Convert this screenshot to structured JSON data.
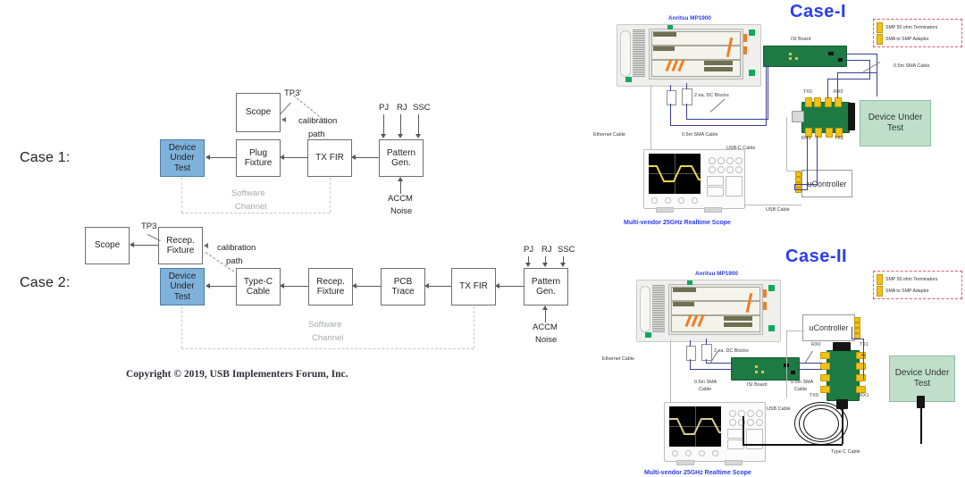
{
  "left_diagram": {
    "case1": {
      "label": "Case 1:",
      "blocks": [
        {
          "id": "dut",
          "text": "Device\nUnder\nTest"
        },
        {
          "id": "plug_fixture",
          "text": "Plug\nFixture"
        },
        {
          "id": "tx_fir",
          "text": "TX FIR"
        },
        {
          "id": "pattern_gen",
          "text": "Pattern\nGen."
        },
        {
          "id": "scope",
          "text": "Scope"
        }
      ],
      "annotations": {
        "tp": "TP3'",
        "calibration_path_line1": "calibration",
        "calibration_path_line2": "path",
        "software_line1": "Software",
        "software_line2": "Channel",
        "accm_line1": "ACCM",
        "accm_line2": "Noise",
        "pj": "PJ",
        "rj": "RJ",
        "ssc": "SSC"
      }
    },
    "case2": {
      "label": "Case 2:",
      "blocks": [
        {
          "id": "scope",
          "text": "Scope"
        },
        {
          "id": "recep_fixture_top",
          "text": "Recep.\nFixture"
        },
        {
          "id": "dut",
          "text": "Device\nUnder\nTest"
        },
        {
          "id": "type_c_cable",
          "text": "Type-C\nCable"
        },
        {
          "id": "recep_fixture",
          "text": "Recep.\nFixture"
        },
        {
          "id": "pcb_trace",
          "text": "PCB\nTrace"
        },
        {
          "id": "tx_fir",
          "text": "TX FIR"
        },
        {
          "id": "pattern_gen",
          "text": "Pattern\nGen."
        }
      ],
      "annotations": {
        "tp": "TP3",
        "calibration_path_line1": "calibration",
        "calibration_path_line2": "path",
        "software_line1": "Software",
        "software_line2": "Channel",
        "accm_line1": "ACCM",
        "accm_line2": "Noise",
        "pj": "PJ",
        "rj": "RJ",
        "ssc": "SSC"
      }
    },
    "copyright": "Copyright © 2019, USB Implementers Forum, Inc."
  },
  "right_panels": {
    "legend": {
      "items": [
        {
          "swatch_color": "#f2c117",
          "label": "SMP 50 ohm Terminators"
        },
        {
          "swatch_color": "#f2c117",
          "label": "SMA to SMP Adaptor"
        }
      ]
    },
    "case_i": {
      "title": "Case-I",
      "instrument": "Anritsu MP1900",
      "isi_board": "ISI Board",
      "dut": "Device Under Test",
      "ucontroller": "uController",
      "scope_caption": "Multi-vendor 25GHz Realtime Scope",
      "labels": {
        "ethernet_cable": "Ethernet Cable",
        "dc_blocks": "2 ea. DC Blocks",
        "sma_cable_left": "0.5m SMA Cable",
        "sma_cable_right": "0.5m SMA Cable",
        "usb_c_cable": "USB-C Cable",
        "usb_cable": "USB Cable",
        "tx0": "TX0",
        "rx0": "RX0",
        "rx1": "RX1",
        "tx1": "TX1"
      }
    },
    "case_ii": {
      "title": "Case-II",
      "instrument": "Anritsu MP1900",
      "isi_board": "ISI Board",
      "dut": "Device Under Test",
      "ucontroller": "uController",
      "scope_caption": "Multi-vendor 25GHz Realtime Scope",
      "labels": {
        "ethernet_cable": "Ethernet Cable",
        "dc_blocks": "2 ea. DC Blocks",
        "sma_cable_left_l1": "0.5m SMA",
        "sma_cable_left_l2": "Cable",
        "sma_cable_right_l1": "0.5m SMA",
        "sma_cable_right_l2": "Cable",
        "usb_cable": "USB Cable",
        "type_c_cable": "Type C Cable",
        "tx0": "TX0",
        "rx0": "RX0",
        "rx1": "RX1",
        "tx1": "TX1"
      }
    }
  },
  "colors": {
    "dut_blue": "#7fb2db",
    "dut_green": "#bfdfcb",
    "title_blue": "#2a3df0",
    "legend_border": "#e8556d",
    "swatch_yellow": "#f2c117",
    "wire_blue": "#3a3f96",
    "board_green": "#1e7a43"
  }
}
